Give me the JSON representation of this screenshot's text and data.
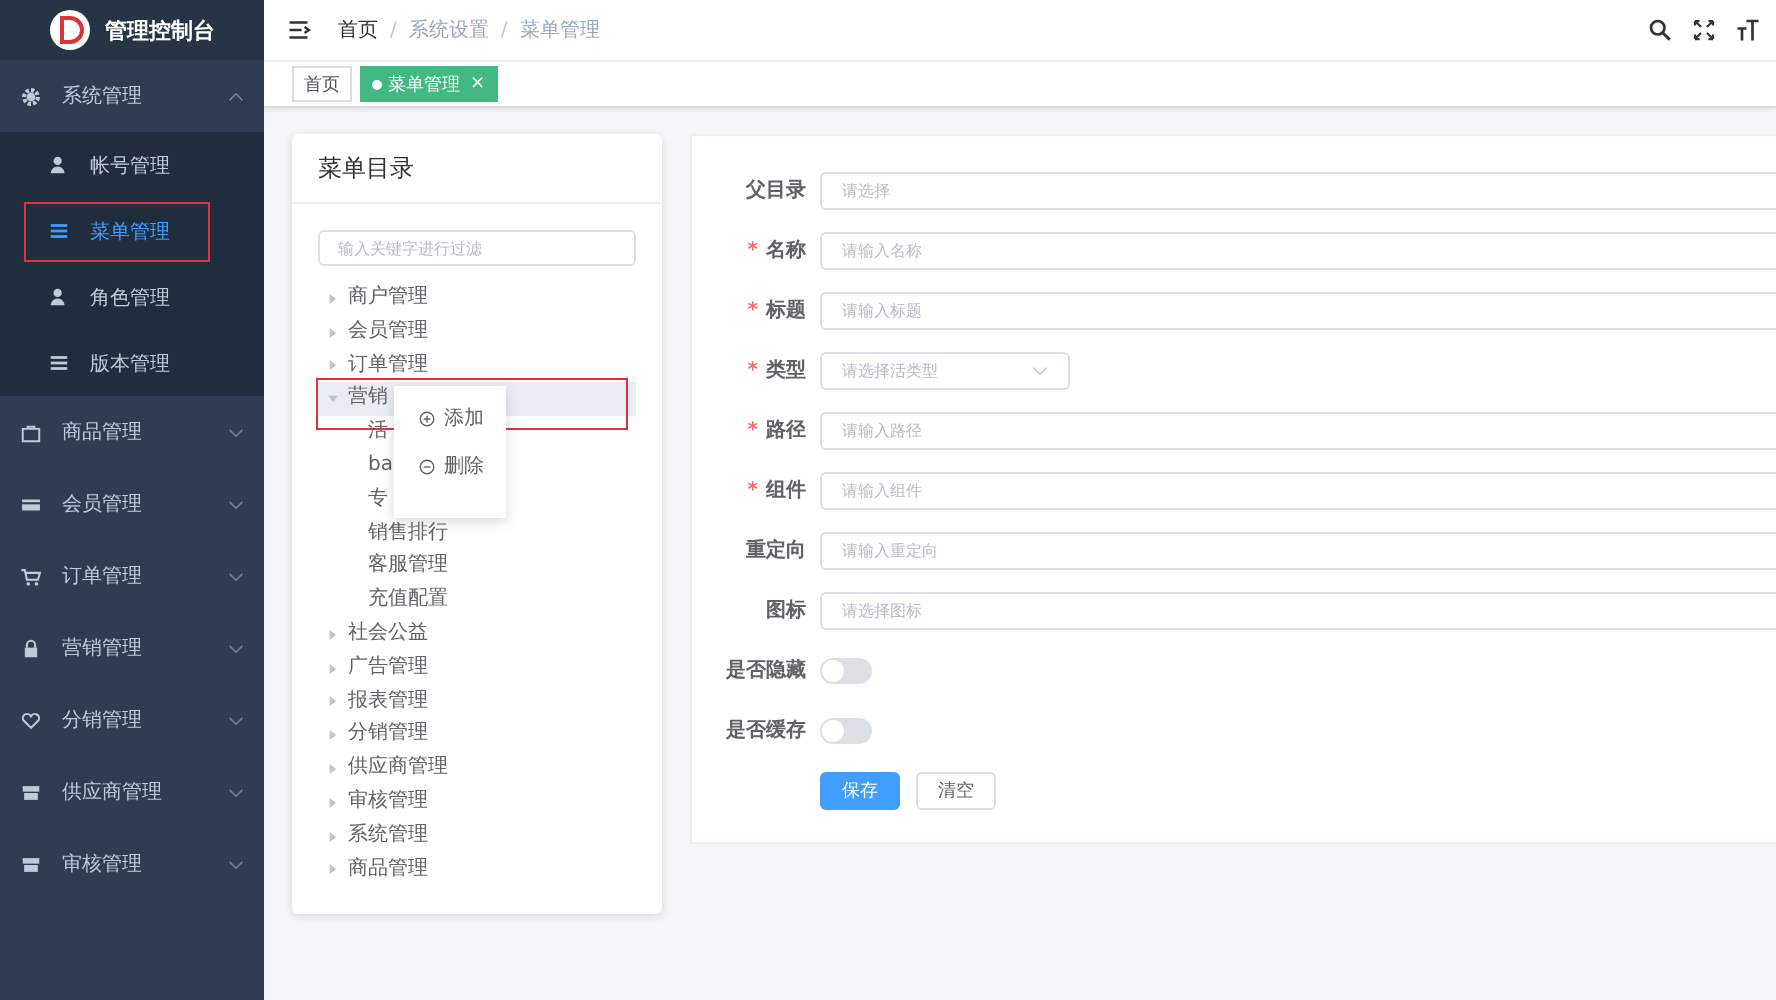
{
  "sidebar": {
    "title": "管理控制台",
    "menu": [
      {
        "label": "系统管理",
        "kind": "gear",
        "expanded": true,
        "children": [
          {
            "label": "帐号管理",
            "kind": "user",
            "selected": false,
            "annotated": false
          },
          {
            "label": "菜单管理",
            "kind": "list",
            "selected": true,
            "annotated": true
          },
          {
            "label": "角色管理",
            "kind": "user",
            "selected": false,
            "annotated": false
          },
          {
            "label": "版本管理",
            "kind": "list",
            "selected": false,
            "annotated": false
          }
        ]
      },
      {
        "label": "商品管理",
        "kind": "bag",
        "expanded": false
      },
      {
        "label": "会员管理",
        "kind": "card",
        "expanded": false
      },
      {
        "label": "订单管理",
        "kind": "cart",
        "expanded": false
      },
      {
        "label": "营销管理",
        "kind": "lock",
        "expanded": false
      },
      {
        "label": "分销管理",
        "kind": "heart",
        "expanded": false
      },
      {
        "label": "供应商管理",
        "kind": "store",
        "expanded": false
      },
      {
        "label": "审核管理",
        "kind": "store",
        "expanded": false
      }
    ]
  },
  "header": {
    "breadcrumb": [
      {
        "label": "首页"
      },
      {
        "separator": "/",
        "label": "系统设置"
      },
      {
        "separator": "/",
        "label": "菜单管理"
      }
    ]
  },
  "tags": [
    {
      "label": "首页",
      "selected": false
    },
    {
      "label": "菜单管理",
      "selected": true,
      "close": "×"
    }
  ],
  "tree_panel": {
    "title": "菜单目录",
    "filter": {
      "placeholder": "输入关键字进行过滤"
    },
    "nodes": [
      {
        "label": "商户管理",
        "expanded": false,
        "selected": false
      },
      {
        "label": "会员管理",
        "expanded": false,
        "selected": false
      },
      {
        "label": "订单管理",
        "expanded": false,
        "selected": false
      },
      {
        "label": "营销",
        "expanded": true,
        "selected": true,
        "annotated": true,
        "children": [
          {
            "label": "活",
            "selected": false
          },
          {
            "label": "ba",
            "selected": false
          },
          {
            "label": "专",
            "selected": false
          },
          {
            "label": "销售排行",
            "selected": false
          },
          {
            "label": "客服管理",
            "selected": false
          },
          {
            "label": "充值配置",
            "selected": false
          }
        ]
      },
      {
        "label": "社会公益",
        "expanded": false,
        "selected": false
      },
      {
        "label": "广告管理",
        "expanded": false,
        "selected": false
      },
      {
        "label": "报表管理",
        "expanded": false,
        "selected": false
      },
      {
        "label": "分销管理",
        "expanded": false,
        "selected": false
      },
      {
        "label": "供应商管理",
        "expanded": false,
        "selected": false
      },
      {
        "label": "审核管理",
        "expanded": false,
        "selected": false
      },
      {
        "label": "系统管理",
        "expanded": false,
        "selected": false
      },
      {
        "label": "商品管理",
        "expanded": false,
        "selected": false
      }
    ]
  },
  "context_menu": [
    {
      "label": "添加",
      "kind": "add"
    },
    {
      "label": "删除",
      "kind": "remove"
    }
  ],
  "form": {
    "fields": [
      {
        "label": "父目录",
        "kind": "input",
        "placeholder": "请选择"
      },
      {
        "label": "名称",
        "required_mark": "*",
        "kind": "input",
        "placeholder": "请输入名称"
      },
      {
        "label": "标题",
        "required_mark": "*",
        "kind": "input",
        "placeholder": "请输入标题"
      },
      {
        "label": "类型",
        "required_mark": "*",
        "kind": "select",
        "placeholder": "请选择活类型"
      },
      {
        "label": "路径",
        "required_mark": "*",
        "kind": "input",
        "placeholder": "请输入路径"
      },
      {
        "label": "组件",
        "required_mark": "*",
        "kind": "input",
        "placeholder": "请输入组件"
      },
      {
        "label": "重定向",
        "kind": "input",
        "placeholder": "请输入重定向"
      },
      {
        "label": "图标",
        "kind": "input",
        "placeholder": "请选择图标"
      },
      {
        "label": "是否隐藏",
        "kind": "switch",
        "on": false
      },
      {
        "label": "是否缓存",
        "kind": "switch",
        "on": false
      }
    ],
    "buttons": [
      {
        "label": "保存",
        "kind": "primary"
      },
      {
        "label": "清空",
        "kind": "plain"
      }
    ]
  }
}
